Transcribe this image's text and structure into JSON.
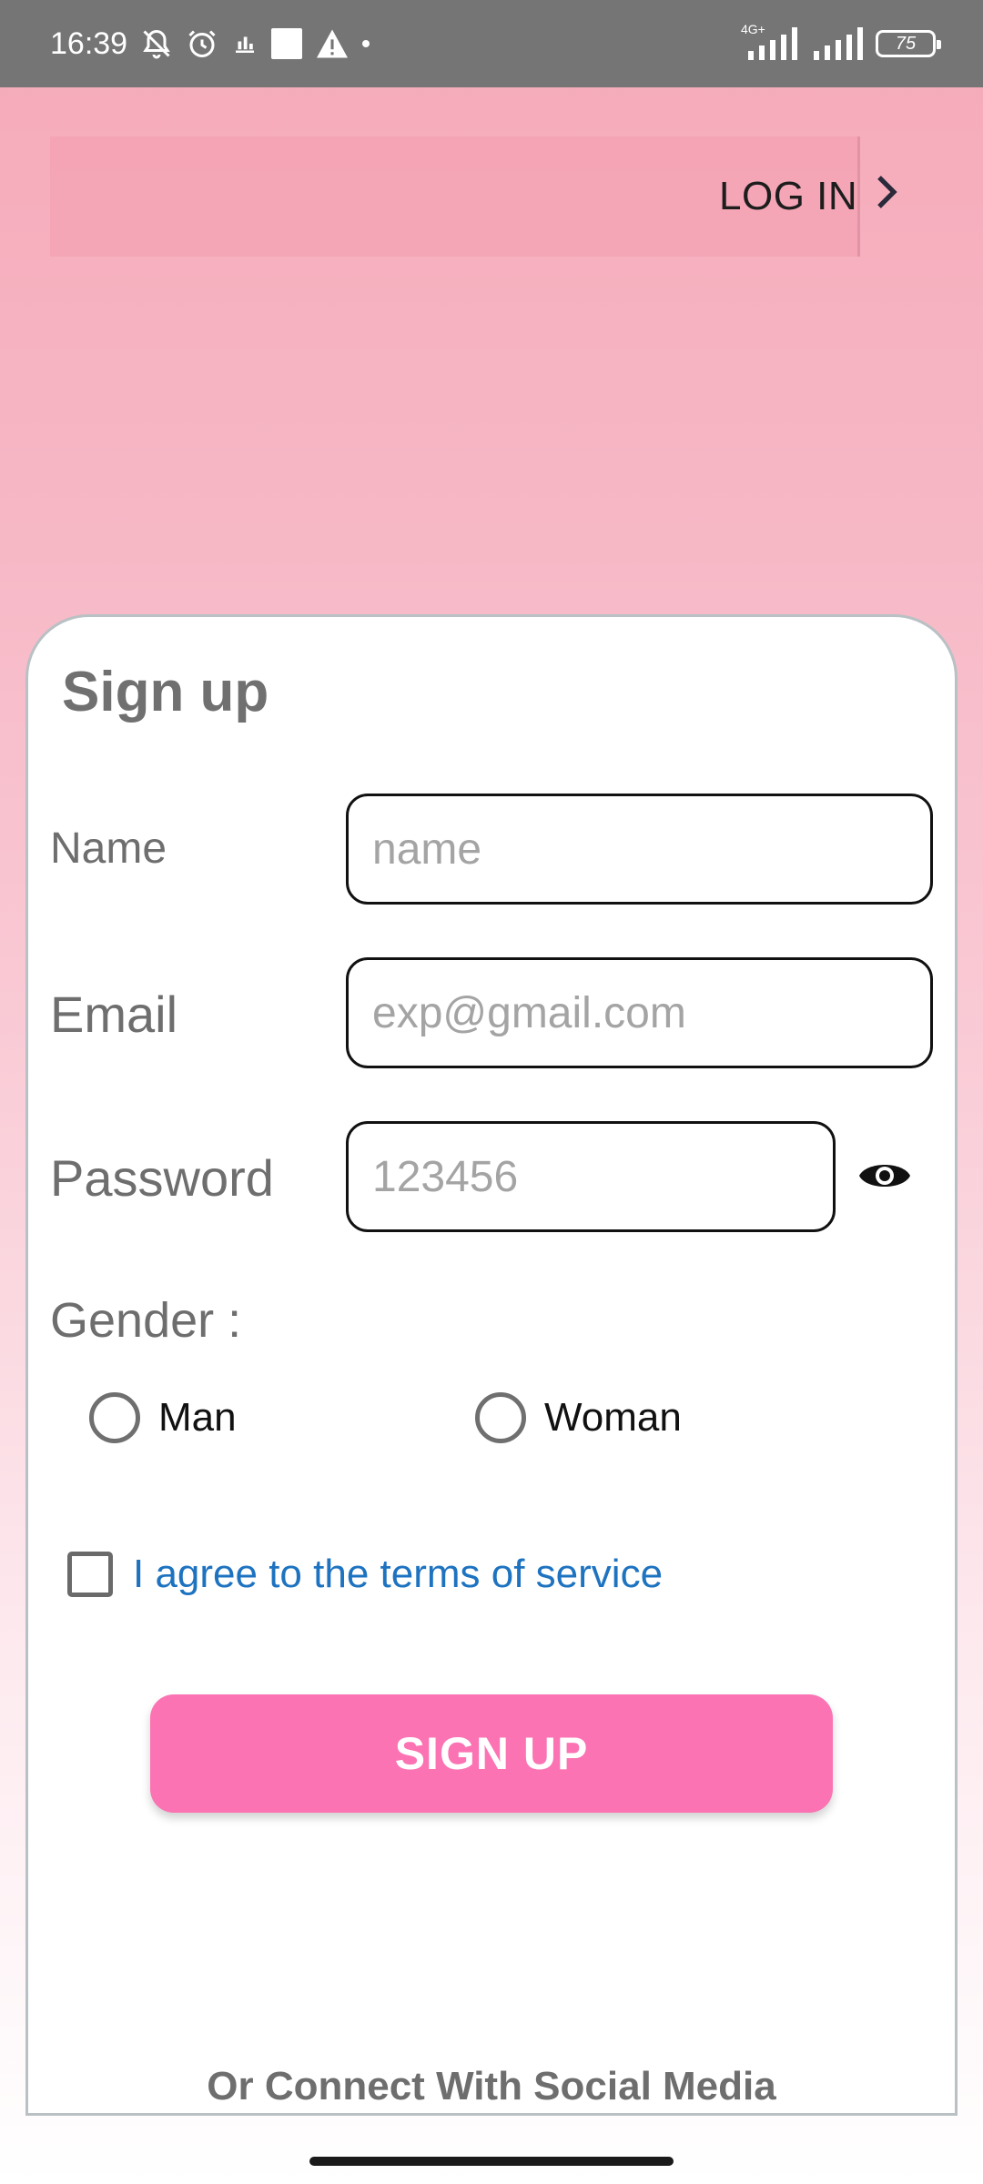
{
  "status_bar": {
    "time": "16:39",
    "network_label": "4G+",
    "battery": "75",
    "icons": [
      "bell-off-icon",
      "alarm-icon",
      "notification-icon",
      "square-icon",
      "warning-icon",
      "dot-icon",
      "signal-icon",
      "signal-icon",
      "battery-icon"
    ]
  },
  "top_bar": {
    "login_label": "LOG IN"
  },
  "form": {
    "title": "Sign up",
    "name_label": "Name",
    "name_placeholder": "name",
    "email_label": "Email",
    "email_placeholder": "exp@gmail.com",
    "password_label": "Password",
    "password_placeholder": "123456",
    "gender_label": "Gender :",
    "gender_options": [
      "Man",
      "Woman"
    ],
    "terms_label": "I agree to the terms of service",
    "signup_label": "SIGN UP",
    "social_label": "Or Connect With Social Media"
  },
  "colors": {
    "accent": "#fb73b3",
    "link": "#1e73c0",
    "status_bar": "#757575"
  }
}
